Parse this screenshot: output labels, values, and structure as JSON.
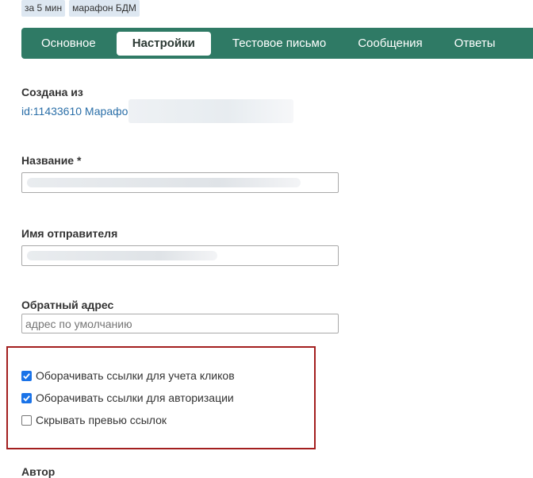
{
  "tags": [
    "за 5 мин",
    "марафон БДМ"
  ],
  "tabs": [
    "Основное",
    "Настройки",
    "Тестовое письмо",
    "Сообщения",
    "Ответы"
  ],
  "active_tab": "Настройки",
  "created_from": {
    "label": "Создана из",
    "link_text": "id:11433610 Марафон"
  },
  "name_field": {
    "label": "Название *"
  },
  "sender_field": {
    "label": "Имя отправителя"
  },
  "reply_field": {
    "label": "Обратный адрес",
    "placeholder": "адрес по умолчанию"
  },
  "checkboxes": [
    {
      "label": "Оборачивать ссылки для учета кликов",
      "checked": true
    },
    {
      "label": "Оборачивать ссылки для авторизации",
      "checked": true
    },
    {
      "label": "Скрывать превью ссылок",
      "checked": false
    }
  ],
  "author_label": "Автор",
  "colors": {
    "tab_bar": "#2f7a65",
    "link": "#2b6fa8",
    "highlight_frame": "#a31f1f",
    "checkbox_on": "#1a73e8"
  }
}
